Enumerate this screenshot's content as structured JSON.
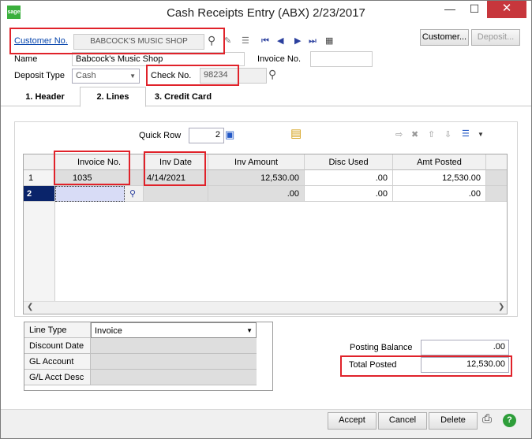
{
  "window": {
    "title": "Cash Receipts Entry (ABX) 2/23/2017",
    "logo": "sage",
    "minimize": "—",
    "maximize": "☐",
    "close": "✕"
  },
  "header": {
    "customer_no_label": "Customer No.",
    "customer_no_value": "BABCOCK'S MUSIC SHOP",
    "name_label": "Name",
    "name_value": "Babcock's Music Shop",
    "invoice_no_label": "Invoice No.",
    "invoice_no_value": "",
    "deposit_type_label": "Deposit Type",
    "deposit_type_value": "Cash",
    "check_no_label": "Check No.",
    "check_no_value": "98234",
    "customer_button": "Customer...",
    "deposit_button": "Deposit..."
  },
  "tabs": [
    {
      "label": "1. Header"
    },
    {
      "label": "2. Lines"
    },
    {
      "label": "3. Credit Card"
    }
  ],
  "lines": {
    "quick_row_label": "Quick Row",
    "quick_row_value": "2",
    "columns": [
      "Invoice No.",
      "Inv Date",
      "Inv Amount",
      "Disc Used",
      "Amt Posted"
    ],
    "rows": [
      {
        "num": "1",
        "invoice": "1035",
        "date": "4/14/2021",
        "amount": "12,530.00",
        "disc": ".00",
        "posted": "12,530.00"
      },
      {
        "num": "2",
        "invoice": "",
        "date": "",
        "amount": ".00",
        "disc": ".00",
        "posted": ".00"
      }
    ]
  },
  "line_detail": {
    "line_type_label": "Line Type",
    "line_type_value": "Invoice",
    "discount_date_label": "Discount Date",
    "gl_account_label": "GL Account",
    "gl_desc_label": "G/L Acct Desc"
  },
  "totals": {
    "posting_balance_label": "Posting Balance",
    "posting_balance_value": ".00",
    "total_posted_label": "Total Posted",
    "total_posted_value": "12,530.00"
  },
  "footer": {
    "accept": "Accept",
    "cancel": "Cancel",
    "delete": "Delete"
  },
  "colors": {
    "highlight": "#e0222a",
    "link": "#0645ad",
    "selected_row": "#0a246a"
  }
}
